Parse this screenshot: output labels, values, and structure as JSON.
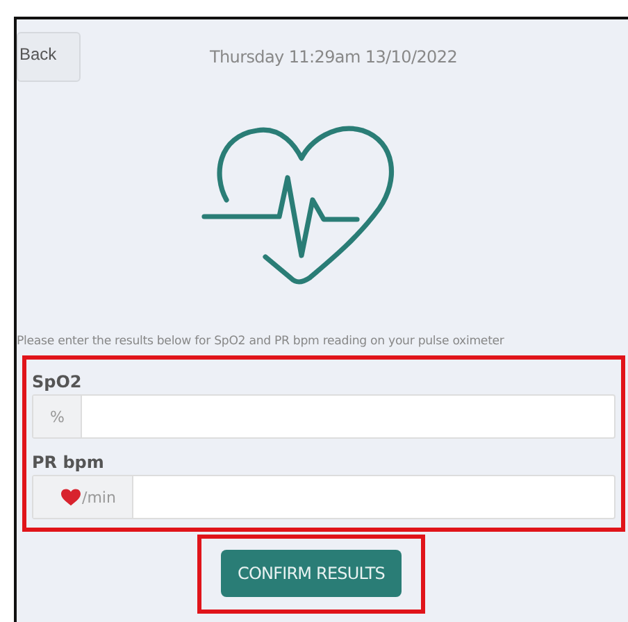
{
  "back_button": {
    "label": "Back"
  },
  "datetime": "Thursday 11:29am 13/10/2022",
  "instruction": "Please enter the results below for SpO2 and PR bpm reading on your pulse oximeter",
  "form": {
    "highlighted": true,
    "fields": [
      {
        "label": "SpO2",
        "unit": "%",
        "kind": "plain"
      },
      {
        "label": "PR bpm",
        "unit": "/min",
        "kind": "heart"
      }
    ]
  },
  "confirm_button": {
    "label": "CONFIRM RESULTS",
    "highlighted": true
  }
}
